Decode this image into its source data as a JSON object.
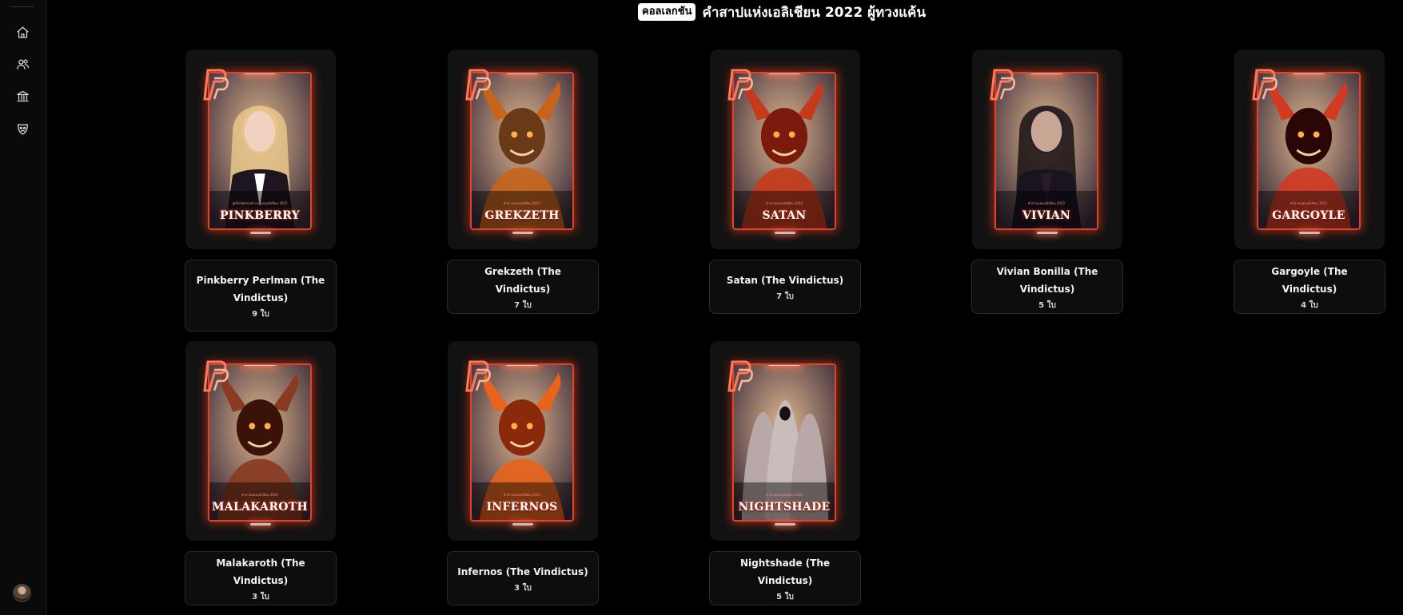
{
  "sidebar": {
    "items": [
      {
        "name": "home-icon"
      },
      {
        "name": "users-icon"
      },
      {
        "name": "bank-icon"
      },
      {
        "name": "mask-icon"
      }
    ]
  },
  "header": {
    "badge": "คอลเลกชัน",
    "title": "คำสาปแห่งเอลิเชียน 2022 ผู้ทวงแค้น"
  },
  "cards": [
    {
      "card_name": "PINKBERRY",
      "card_sub": "@Pinkberryคำสาปแห่งเอลิเชียน 2022",
      "title": "Pinkberry Perlman (The Vindictus)",
      "count": "9 ใบ",
      "art": "portrait-blonde",
      "colors": [
        "#3a2b3a",
        "#e0b78e",
        "#1d1620"
      ]
    },
    {
      "card_name": "GREKZETH",
      "card_sub": "คำสาปแห่งเอลิเชียน 2022",
      "title": "Grekzeth (The Vindictus)",
      "count": "7 ใบ",
      "art": "skull-fire",
      "colors": [
        "#2a1608",
        "#c7641c",
        "#6a3a18"
      ]
    },
    {
      "card_name": "SATAN",
      "card_sub": "คำสาปแห่งเอลิเชียน 2022",
      "title": "Satan (The Vindictus)",
      "count": "7 ใบ",
      "art": "demon-red",
      "colors": [
        "#3b0806",
        "#c53a1a",
        "#7a1a0c"
      ]
    },
    {
      "card_name": "VIVIAN",
      "card_sub": "คำสาปแห่งเอลิเชียน 2022",
      "title": "Vivian Bonilla (The Vindictus)",
      "count": "5 ใบ",
      "art": "portrait-dark",
      "colors": [
        "#2a2040",
        "#7b6ca8",
        "#1a1320"
      ]
    },
    {
      "card_name": "GARGOYLE",
      "card_sub": "คำสาปแห่งเอลิเชียน 2022",
      "title": "Gargoyle (The Vindictus)",
      "count": "4 ใบ",
      "art": "gargoyle-red",
      "colors": [
        "#4a0808",
        "#d23a22",
        "#2a0606"
      ]
    },
    {
      "card_name": "MALAKAROTH",
      "card_sub": "คำสาปแห่งเอลิเชียน 2022",
      "title": "Malakaroth (The Vindictus)",
      "count": "3 ใบ",
      "art": "dragon-dark",
      "colors": [
        "#1d0c08",
        "#8a3a20",
        "#3a1208"
      ]
    },
    {
      "card_name": "INFERNOS",
      "card_sub": "คำสาปแห่งเอลิเชียน 2022",
      "title": "Infernos (The Vindictus)",
      "count": "3 ใบ",
      "art": "horned-beast",
      "colors": [
        "#4a1404",
        "#e8641c",
        "#8a2a0a"
      ]
    },
    {
      "card_name": "NIGHTSHADE",
      "card_sub": "คำสาปแห่งเอลิเชียน 2022",
      "title": "Nightshade (The Vindictus)",
      "count": "5 ใบ",
      "art": "hooded-figures",
      "colors": [
        "#3a2a2a",
        "#b8a8a8",
        "#5a4646"
      ]
    }
  ],
  "accent_color": "#e2422a"
}
